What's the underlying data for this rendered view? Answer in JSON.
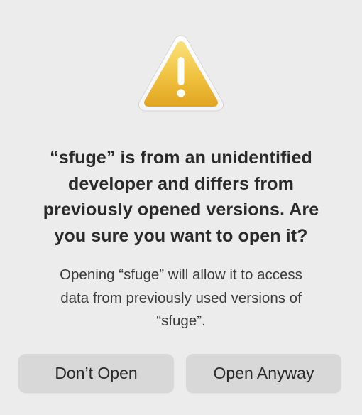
{
  "dialog": {
    "icon": "warning-triangle-icon",
    "title_lines": [
      "“sfuge” is from an unidentified",
      "developer and differs from",
      "previously opened versions. Are",
      "you sure you want to open it?"
    ],
    "message_lines": [
      "Opening “sfuge” will allow it to access",
      "data from previously used versions of",
      "“sfuge”."
    ],
    "buttons": {
      "dont_open": "Don’t Open",
      "open_anyway": "Open Anyway"
    }
  },
  "colors": {
    "background": "#ececec",
    "button": "#d8d8d8",
    "warning_yellow": "#f2c14a",
    "text": "#2a2a2a"
  }
}
